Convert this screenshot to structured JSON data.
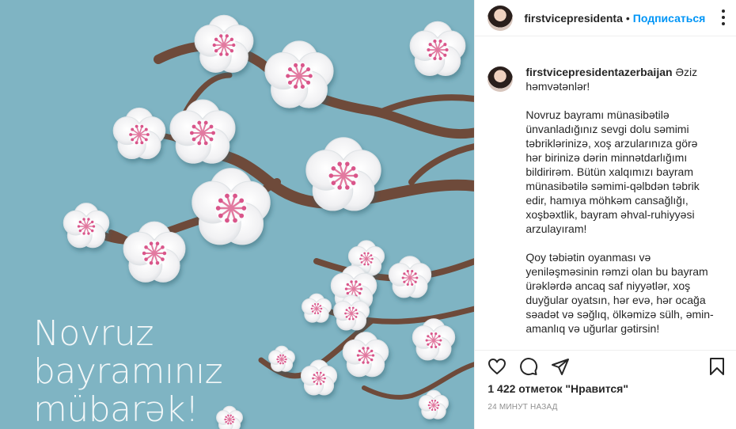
{
  "image": {
    "greeting_lines": [
      "Novruz",
      "bayramınız",
      "mübarək!"
    ],
    "background_color": "#7fb4c3"
  },
  "header": {
    "username": "firstvicepresidenta",
    "separator": "•",
    "follow_label": "Подписаться",
    "more_icon": "more-options-icon"
  },
  "caption": {
    "username": "firstvicepresidentazerbaijan",
    "greeting": "Əziz həmvətənlər!",
    "paragraphs": [
      "Novruz bayramı münasibətilə ünvanladığınız sevgi dolu səmimi təbriklərinizə, xoş arzularınıza görə hər birinizə dərin minnətdarlığımı bildirirəm. Bütün xalqımızı bayram münasibətilə səmimi-qəlbdən təbrik edir, hamıya möhkəm cansağlığı, xoşbəxtlik, bayram əhval-ruhiyyəsi arzulayıram!",
      "Qoy təbiətin oyanması və yeniləşməsinin rəmzi olan bu bayram ürəklərdə ancaq saf niyyətlər, xoş duyğular oyatsın, hər evə, hər ocağa səadət və səğlıq, ölkəmizə sülh, əmin-amanlıq və uğurlar gətirsin!"
    ]
  },
  "actions": {
    "icons": [
      "heart-icon",
      "comment-icon",
      "share-icon",
      "bookmark-icon"
    ],
    "likes": "1 422 отметок \"Нравится\"",
    "timestamp": "24 МИНУТ НАЗАД"
  },
  "colors": {
    "accent": "#0095f6",
    "text": "#262626",
    "muted": "#8e8e8e",
    "border": "#efefef"
  }
}
